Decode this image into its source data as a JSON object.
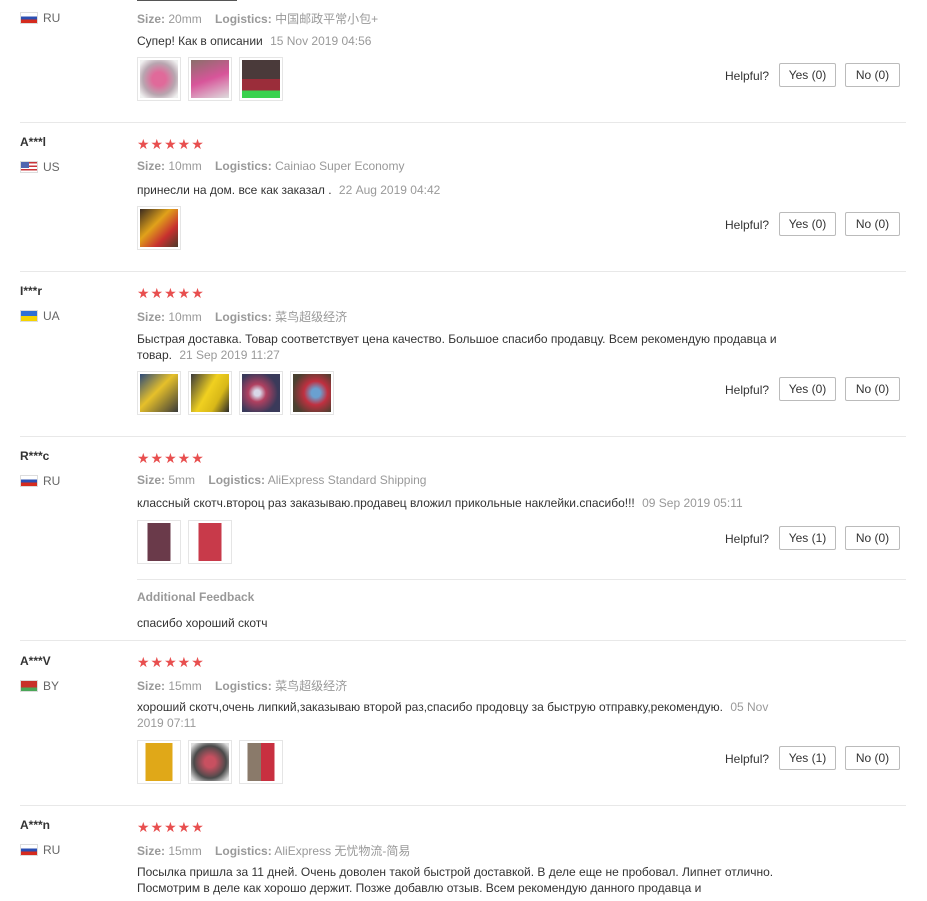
{
  "labels": {
    "size": "Size:",
    "logistics": "Logistics:",
    "helpful": "Helpful?",
    "additional_feedback": "Additional Feedback"
  },
  "colors": {
    "star": "#e84f4f",
    "muted": "#999999"
  },
  "reviews": [
    {
      "user": "",
      "country": "RU",
      "size": "20mm",
      "logistics": "中国邮政平常小包+",
      "text": "Супер! Как в описании",
      "date": "15 Nov 2019 04:56",
      "yes": "Yes (0)",
      "no": "No (0)"
    },
    {
      "user": "A***l",
      "country": "US",
      "stars": "★★★★★",
      "size": "10mm",
      "logistics": "Cainiao Super Economy",
      "text": "принесли на дом. все как заказал .",
      "date": "22 Aug 2019 04:42",
      "yes": "Yes (0)",
      "no": "No (0)"
    },
    {
      "user": "I***r",
      "country": "UA",
      "stars": "★★★★★",
      "size": "10mm",
      "logistics": "菜鸟超级经济",
      "text": "Быстрая доставка. Товар соответствует цена качество. Большое спасибо продавцу. Всем рекомендую продавца и товар.",
      "date": "21 Sep 2019 11:27",
      "yes": "Yes (0)",
      "no": "No (0)"
    },
    {
      "user": "R***c",
      "country": "RU",
      "stars": "★★★★★",
      "size": "5mm",
      "logistics": "AliExpress Standard Shipping",
      "text": "классный скотч.второц раз заказываю.продавец вложил прикольные наклейки.спасибо!!!",
      "date": "09 Sep 2019 05:11",
      "yes": "Yes (1)",
      "no": "No (0)",
      "additional": "спасибо хороший скотч"
    },
    {
      "user": "A***V",
      "country": "BY",
      "stars": "★★★★★",
      "size": "15mm",
      "logistics": "菜鸟超级经济",
      "text": "хороший скотч,очень липкий,заказываю второй раз,спасибо продовцу за быструю отправку,рекомендую.",
      "date": "05 Nov 2019 07:11",
      "yes": "Yes (1)",
      "no": "No (0)"
    },
    {
      "user": "A***n",
      "country": "RU",
      "stars": "★★★★★",
      "size": "15mm",
      "logistics": "AliExpress 无忧物流-简易",
      "text": "Посылка пришла за 11 дней. Очень доволен такой быстрой доставкой. В деле еще не пробовал. Липнет отлично. Посмотрим в деле как хорошо держит. Позже добавлю отзыв. Всем рекомендую данного продавца и"
    }
  ]
}
